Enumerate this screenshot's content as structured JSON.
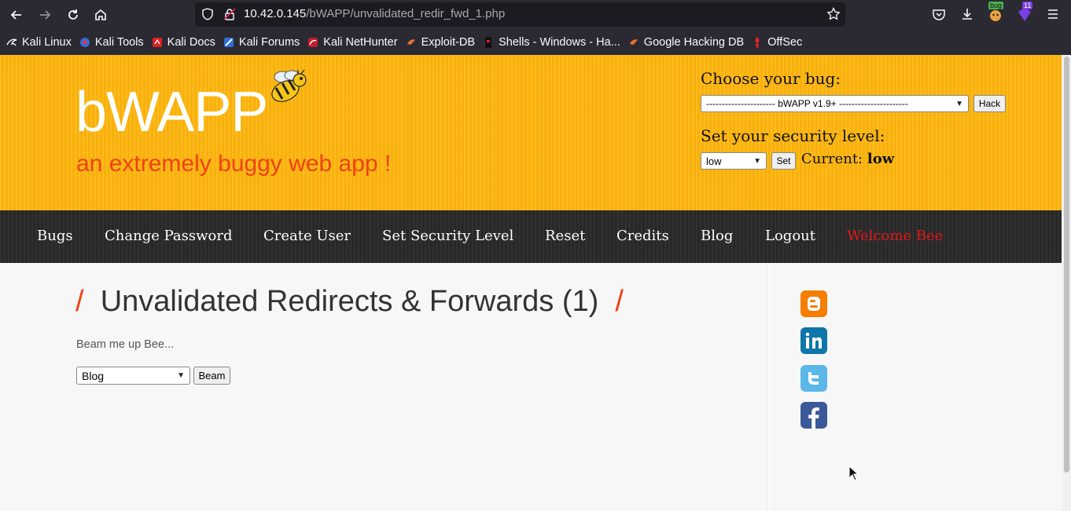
{
  "browser": {
    "url_host": "10.42.0.145",
    "url_path": "/bWAPP/unvalidated_redir_fwd_1.php",
    "bookmarks": [
      "Kali Linux",
      "Kali Tools",
      "Kali Docs",
      "Kali Forums",
      "Kali NetHunter",
      "Exploit-DB",
      "Shells - Windows - Ha...",
      "Google Hacking DB",
      "OffSec"
    ],
    "ext_badge_bug": "bug",
    "ext_badge_count": "11"
  },
  "header": {
    "logo": "bWAPP",
    "tagline": "an extremely buggy web app !",
    "choose_bug_label": "Choose your bug:",
    "bug_selected": "---------------------- bWAPP v1.9+ ----------------------",
    "hack_button": "Hack",
    "security_label": "Set your security level:",
    "security_selected": "low",
    "set_button": "Set",
    "current_label": "Current:",
    "current_value": "low"
  },
  "menu": {
    "items": [
      "Bugs",
      "Change Password",
      "Create User",
      "Set Security Level",
      "Reset",
      "Credits",
      "Blog",
      "Logout",
      "Welcome Bee"
    ]
  },
  "content": {
    "slash": "/",
    "title": "Unvalidated Redirects & Forwards (1)",
    "intro": "Beam me up Bee...",
    "destination_selected": "Blog",
    "beam_button": "Beam"
  },
  "colors": {
    "header_bg": "#ffb70f",
    "accent_red": "#ee4215",
    "menu_bg": "#2a2a2a",
    "welcome": "#e3161b"
  },
  "icons": [
    "blogger-icon",
    "linkedin-icon",
    "twitter-icon",
    "facebook-icon"
  ]
}
